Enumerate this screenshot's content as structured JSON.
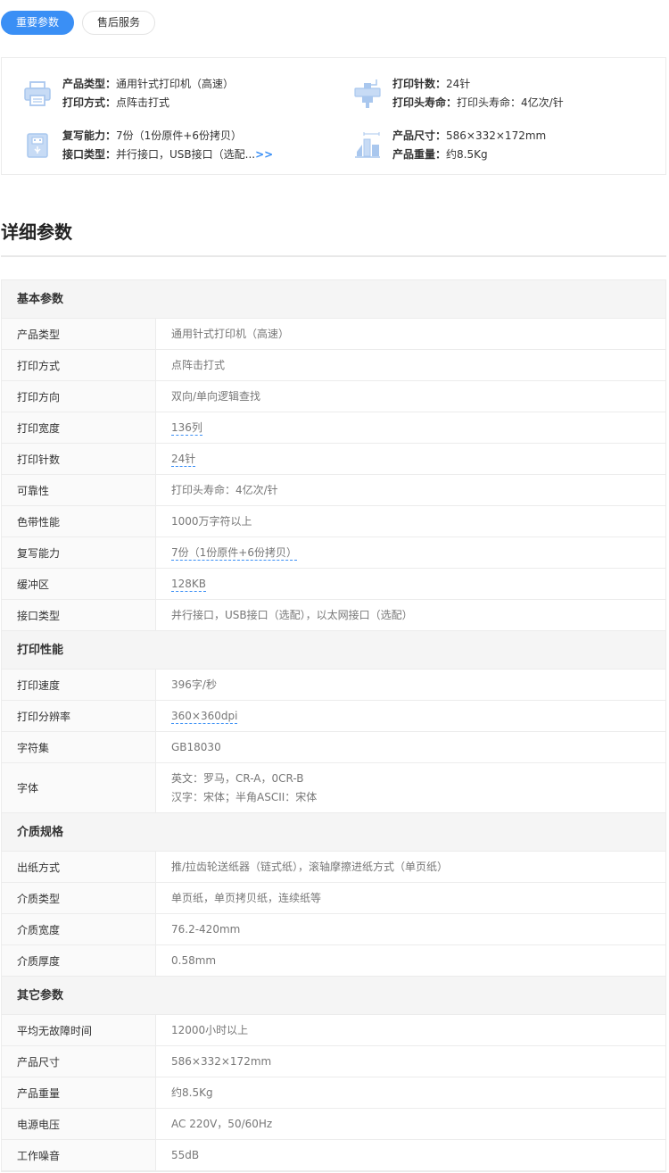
{
  "tabs": [
    {
      "label": "重要参数",
      "active": true
    },
    {
      "label": "售后服务",
      "active": false
    }
  ],
  "summary": {
    "left_top": {
      "icon": "printer-icon",
      "lines": [
        {
          "key": "产品类型：",
          "value": "通用针式打印机（高速）"
        },
        {
          "key": "打印方式：",
          "value": "点阵击打式"
        }
      ]
    },
    "right_top": {
      "icon": "print-head-icon",
      "lines": [
        {
          "key": "打印针数：",
          "value": "24针"
        },
        {
          "key": "打印头寿命：",
          "value": "打印头寿命：4亿次/针"
        }
      ]
    },
    "left_bottom": {
      "icon": "usb-icon",
      "lines": [
        {
          "key": "复写能力：",
          "value": "7份（1份原件+6份拷贝）"
        },
        {
          "key": "接口类型：",
          "value": "并行接口，USB接口（选配...",
          "more": ">>"
        }
      ]
    },
    "right_bottom": {
      "icon": "dimensions-icon",
      "lines": [
        {
          "key": "产品尺寸：",
          "value": "586×332×172mm"
        },
        {
          "key": "产品重量：",
          "value": "约8.5Kg"
        }
      ]
    }
  },
  "detail_title": "详细参数",
  "sections": [
    {
      "title": "基本参数",
      "rows": [
        {
          "k": "产品类型",
          "v": [
            "通用针式打印机（高速）"
          ],
          "link": false
        },
        {
          "k": "打印方式",
          "v": [
            "点阵击打式"
          ],
          "link": false
        },
        {
          "k": "打印方向",
          "v": [
            "双向/单向逻辑查找"
          ],
          "link": false
        },
        {
          "k": "打印宽度",
          "v": [
            "136列"
          ],
          "link": true
        },
        {
          "k": "打印针数",
          "v": [
            "24针"
          ],
          "link": true
        },
        {
          "k": "可靠性",
          "v": [
            "打印头寿命：4亿次/针"
          ],
          "link": false
        },
        {
          "k": "色带性能",
          "v": [
            "1000万字符以上"
          ],
          "link": false
        },
        {
          "k": "复写能力",
          "v": [
            "7份（1份原件+6份拷贝）"
          ],
          "link": true
        },
        {
          "k": "缓冲区",
          "v": [
            "128KB"
          ],
          "link": true
        },
        {
          "k": "接口类型",
          "v": [
            "并行接口，USB接口（选配），以太网接口（选配）"
          ],
          "link": false
        }
      ]
    },
    {
      "title": "打印性能",
      "rows": [
        {
          "k": "打印速度",
          "v": [
            "396字/秒"
          ],
          "link": false
        },
        {
          "k": "打印分辨率",
          "v": [
            "360×360dpi"
          ],
          "link": true
        },
        {
          "k": "字符集",
          "v": [
            "GB18030"
          ],
          "link": false
        },
        {
          "k": "字体",
          "v": [
            "英文：罗马，CR-A，0CR-B",
            "汉字：宋体；半角ASCII：宋体"
          ],
          "link": false
        }
      ]
    },
    {
      "title": "介质规格",
      "rows": [
        {
          "k": "出纸方式",
          "v": [
            "推/拉齿轮送纸器（链式纸），滚轴摩擦进纸方式（单页纸）"
          ],
          "link": false
        },
        {
          "k": "介质类型",
          "v": [
            "单页纸，单页拷贝纸，连续纸等"
          ],
          "link": false
        },
        {
          "k": "介质宽度",
          "v": [
            "76.2-420mm"
          ],
          "link": false
        },
        {
          "k": "介质厚度",
          "v": [
            "0.58mm"
          ],
          "link": false
        }
      ]
    },
    {
      "title": "其它参数",
      "rows": [
        {
          "k": "平均无故障时间",
          "v": [
            "12000小时以上"
          ],
          "link": false
        },
        {
          "k": "产品尺寸",
          "v": [
            "586×332×172mm"
          ],
          "link": false
        },
        {
          "k": "产品重量",
          "v": [
            "约8.5Kg"
          ],
          "link": false
        },
        {
          "k": "电源电压",
          "v": [
            "AC 220V，50/60Hz"
          ],
          "link": false
        },
        {
          "k": "工作噪音",
          "v": [
            "55dB"
          ],
          "link": false
        }
      ]
    }
  ],
  "colors": {
    "accent": "#3a8ff5",
    "icon": "#a9c7ee"
  }
}
